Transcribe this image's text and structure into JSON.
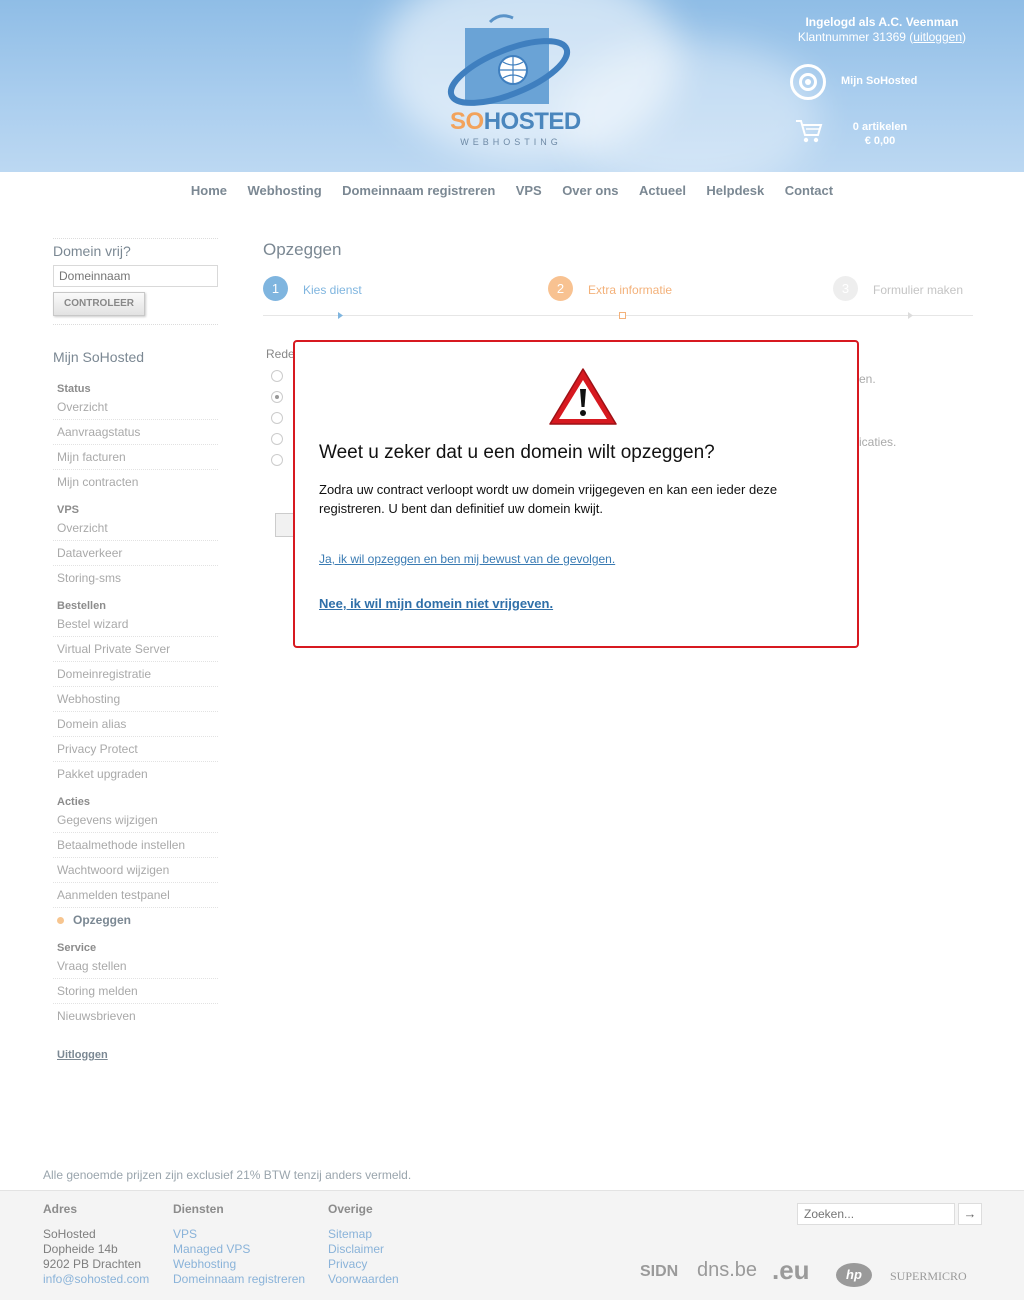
{
  "header": {
    "logo": {
      "part1": "SO",
      "part2": "HOSTED",
      "sub": "WEBHOSTING"
    },
    "user": {
      "logged_in": "Ingelogd als A.C. Veenman",
      "customer": "Klantnummer 31369 (",
      "logout": "uitloggen",
      "close": ")"
    },
    "my_sohosted": "Mijn SoHosted",
    "cart": {
      "items": "0 artikelen",
      "total": "€ 0,00"
    }
  },
  "nav": [
    "Home",
    "Webhosting",
    "Domeinnaam registreren",
    "VPS",
    "Over ons",
    "Actueel",
    "Helpdesk",
    "Contact"
  ],
  "sidebar": {
    "domain_title": "Domein vrij?",
    "domain_placeholder": "Domeinnaam",
    "check_button": "CONTROLEER",
    "my_title": "Mijn SoHosted",
    "sections": [
      {
        "title": "Status",
        "items": [
          "Overzicht",
          "Aanvraagstatus",
          "Mijn facturen",
          "Mijn contracten"
        ]
      },
      {
        "title": "VPS",
        "items": [
          "Overzicht",
          "Dataverkeer",
          "Storing-sms"
        ]
      },
      {
        "title": "Bestellen",
        "items": [
          "Bestel wizard",
          "Virtual Private Server",
          "Domeinregistratie",
          "Webhosting",
          "Domein alias",
          "Privacy Protect",
          "Pakket upgraden"
        ]
      },
      {
        "title": "Acties",
        "items": [
          "Gegevens wijzigen",
          "Betaalmethode instellen",
          "Wachtwoord wijzigen",
          "Aanmelden testpanel",
          "Opzeggen"
        ]
      },
      {
        "title": "Service",
        "items": [
          "Vraag stellen",
          "Storing melden",
          "Nieuwsbrieven"
        ]
      }
    ],
    "active_item": "Opzeggen",
    "logout": "Uitloggen"
  },
  "content": {
    "title": "Opzeggen",
    "steps": [
      {
        "num": "1",
        "label": "Kies dienst",
        "state": "done"
      },
      {
        "num": "2",
        "label": "Extra informatie",
        "state": "current"
      },
      {
        "num": "3",
        "label": "Formulier maken",
        "state": "todo"
      }
    ],
    "bg_label": "Rede",
    "bg_right1": "en.",
    "bg_right2": "icaties."
  },
  "modal": {
    "title": "Weet u zeker dat u een domein wilt opzeggen?",
    "text": "Zodra uw contract verloopt wordt uw domein vrijgegeven en kan een ieder deze registreren. U bent dan definitief uw domein kwijt.",
    "yes": "Ja, ik wil opzeggen en ben mij bewust van de gevolgen.",
    "no": "Nee, ik wil mijn domein niet vrijgeven."
  },
  "footer": {
    "vat_note": "Alle genoemde prijzen zijn exclusief 21% BTW tenzij anders vermeld.",
    "address": {
      "title": "Adres",
      "lines": [
        "SoHosted",
        "Dopheide 14b",
        "9202 PB Drachten"
      ],
      "email": "info@sohosted.com"
    },
    "services": {
      "title": "Diensten",
      "links": [
        "VPS",
        "Managed VPS",
        "Webhosting",
        "Domeinnaam registreren"
      ]
    },
    "other": {
      "title": "Overige",
      "links": [
        "Sitemap",
        "Disclaimer",
        "Privacy",
        "Voorwaarden"
      ]
    },
    "search_placeholder": "Zoeken...",
    "partners": [
      "SIDN",
      "dns.be",
      ".eu",
      "hp",
      "SUPERMICRO"
    ]
  },
  "colors": {
    "brand_blue": "#4a86bd",
    "brand_orange": "#f2a35c",
    "modal_border": "#d71920",
    "link": "#3a7bb3"
  }
}
